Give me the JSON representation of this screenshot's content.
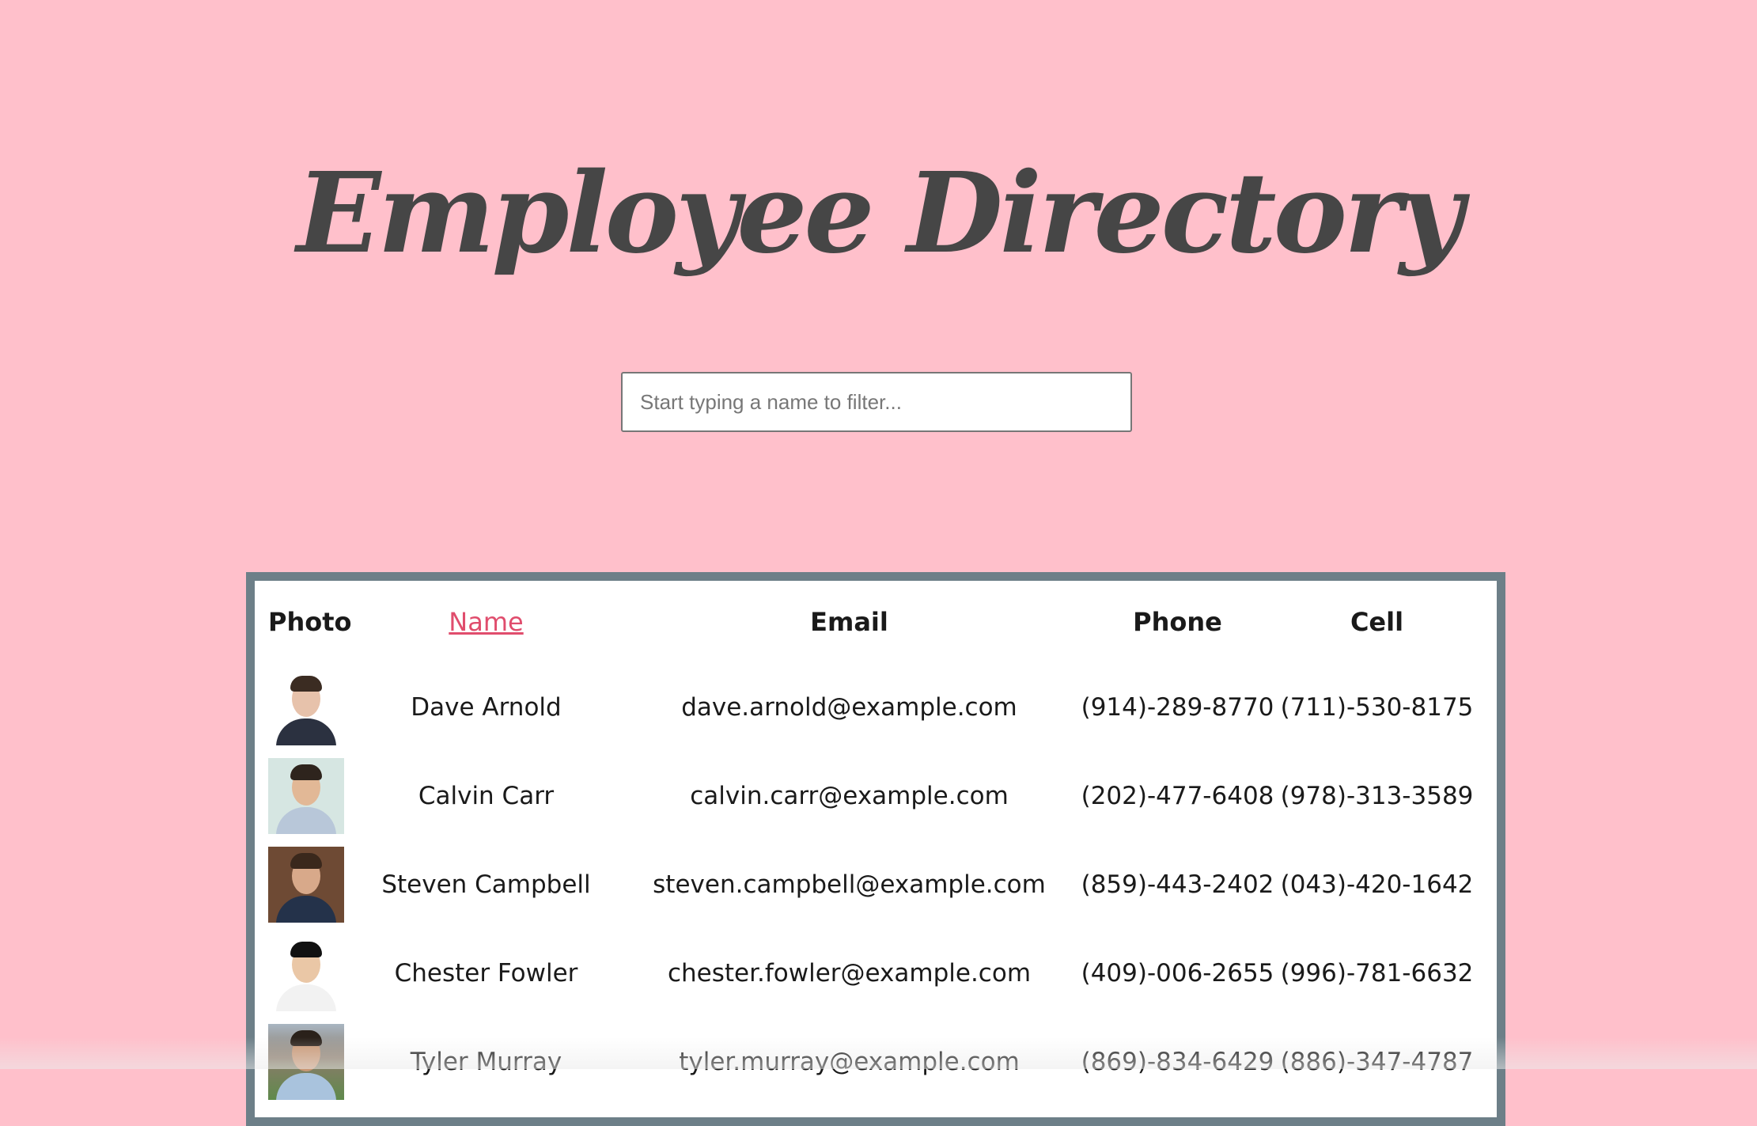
{
  "header": {
    "title": "Employee Directory"
  },
  "search": {
    "placeholder": "Start typing a name to filter..."
  },
  "table": {
    "columns": {
      "photo": "Photo",
      "name": "Name",
      "email": "Email",
      "phone": "Phone",
      "cell": "Cell"
    },
    "rows": [
      {
        "name": "Dave Arnold",
        "email": "dave.arnold@example.com",
        "phone": "(914)-289-8770",
        "cell": "(711)-530-8175"
      },
      {
        "name": "Calvin Carr",
        "email": "calvin.carr@example.com",
        "phone": "(202)-477-6408",
        "cell": "(978)-313-3589"
      },
      {
        "name": "Steven Campbell",
        "email": "steven.campbell@example.com",
        "phone": "(859)-443-2402",
        "cell": "(043)-420-1642"
      },
      {
        "name": "Chester Fowler",
        "email": "chester.fowler@example.com",
        "phone": "(409)-006-2655",
        "cell": "(996)-781-6632"
      },
      {
        "name": "Tyler Murray",
        "email": "tyler.murray@example.com",
        "phone": "(869)-834-6429",
        "cell": "(886)-347-4787"
      }
    ]
  },
  "colors": {
    "background": "#ffc0cb",
    "title": "#464646",
    "table_border": "#6d7f88",
    "sort_link": "#e04d6d"
  }
}
